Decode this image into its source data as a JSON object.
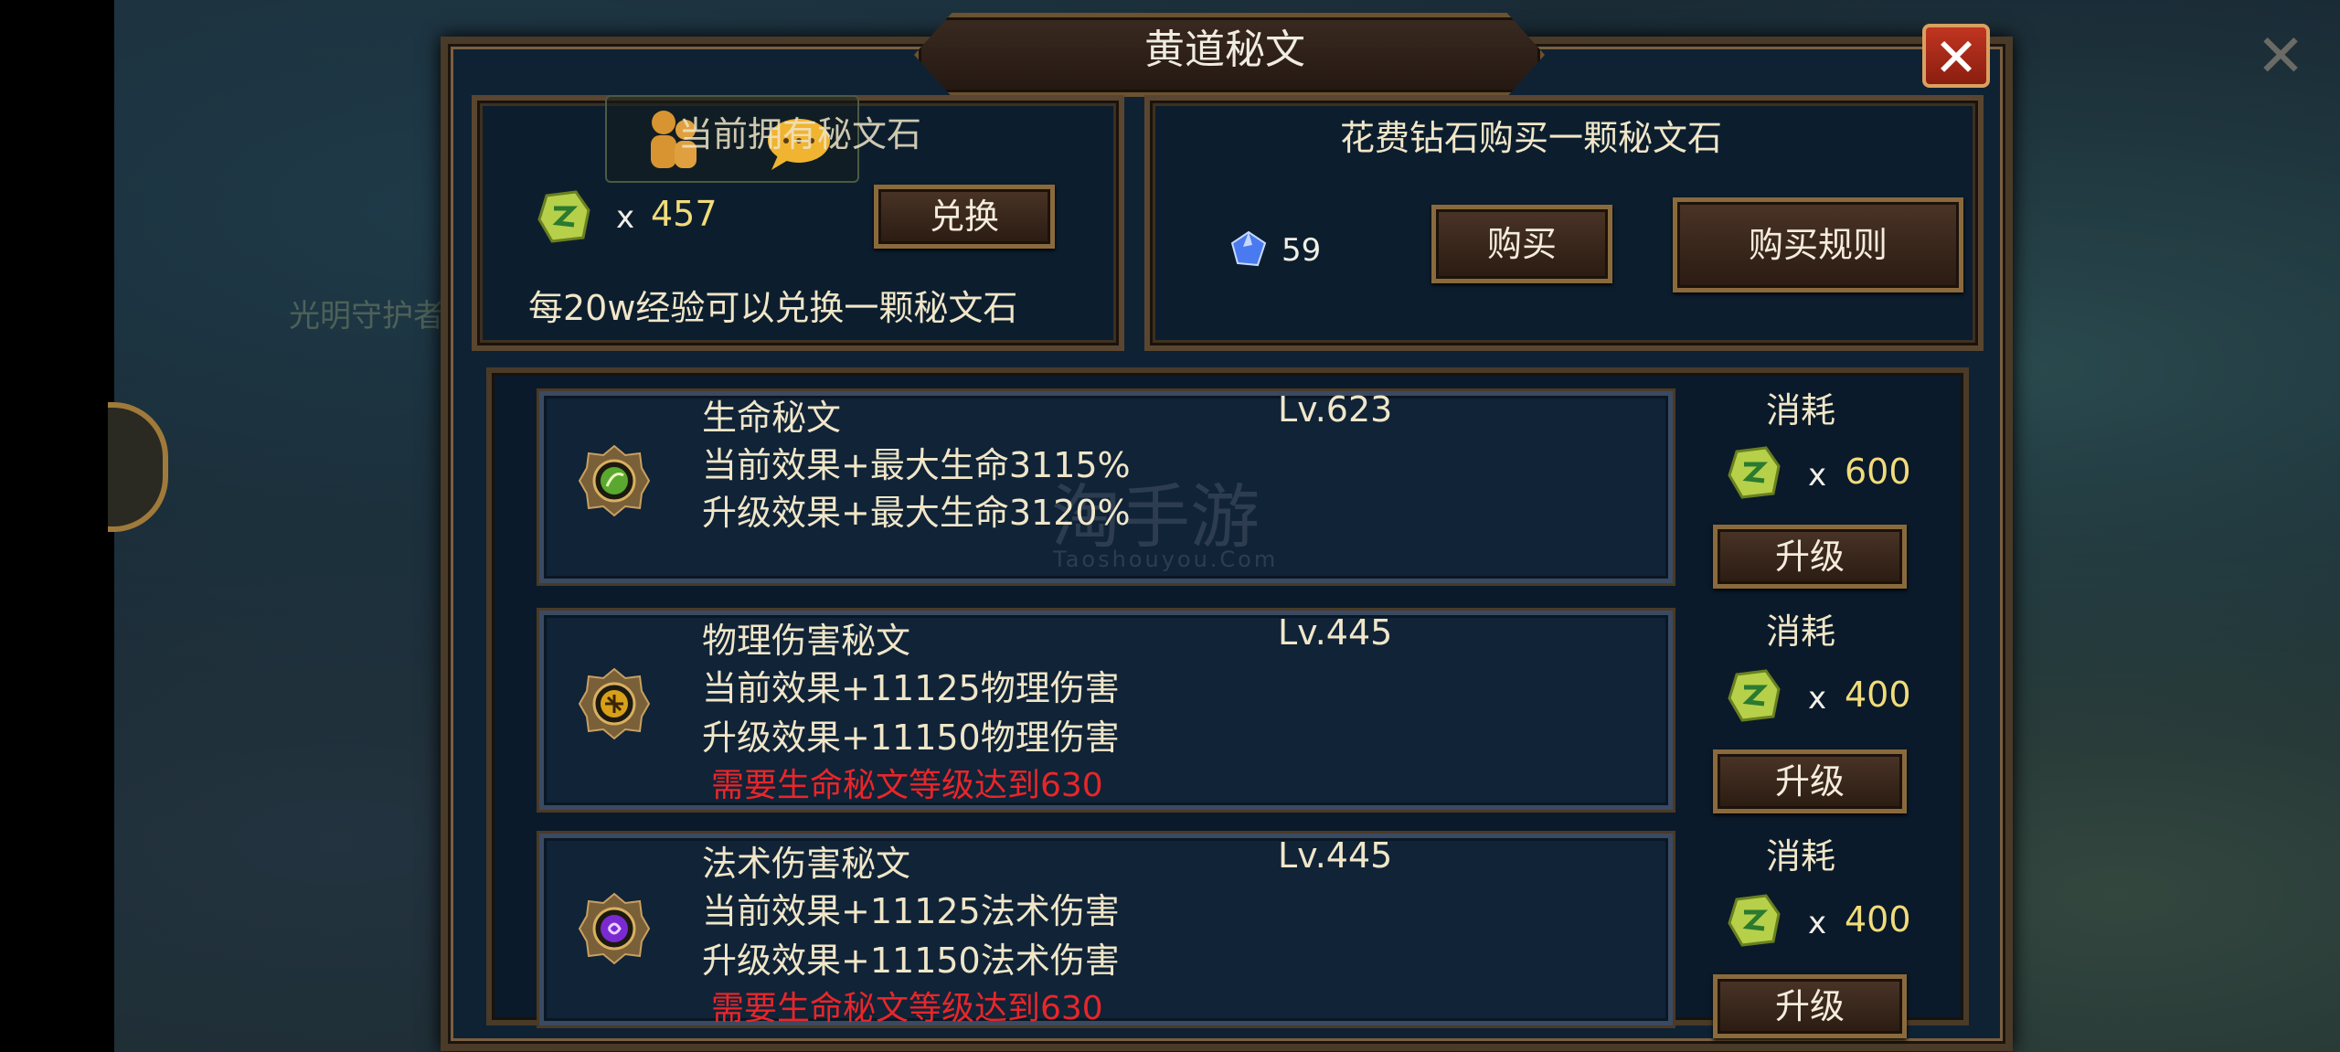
{
  "window": {
    "title": "黄道秘文",
    "close_symbol": "✕"
  },
  "background": {
    "close_symbol": "✕",
    "side_text": "光明守护者"
  },
  "stones_panel": {
    "label": "当前拥有秘文石",
    "count_prefix": "x",
    "count": "457",
    "exchange_button": "兑换",
    "hint": "每20w经验可以兑换一颗秘文石"
  },
  "purchase_panel": {
    "label": "花费钻石购买一颗秘文石",
    "diamond_count": "59",
    "buy_button": "购买",
    "rules_button": "购买规则"
  },
  "runes": [
    {
      "name": "生命秘文",
      "level": "Lv.623",
      "current": "当前效果+最大生命3115%",
      "upgrade": "升级效果+最大生命3120%",
      "requirement": "",
      "cost_label": "消耗",
      "cost_prefix": "x",
      "cost": "600",
      "upgrade_button": "升级",
      "icon": "life-rune-icon",
      "icon_color": "#5aa830"
    },
    {
      "name": "物理伤害秘文",
      "level": "Lv.445",
      "current": "当前效果+11125物理伤害",
      "upgrade": "升级效果+11150物理伤害",
      "requirement": "需要生命秘文等级达到630",
      "cost_label": "消耗",
      "cost_prefix": "x",
      "cost": "400",
      "upgrade_button": "升级",
      "icon": "physical-rune-icon",
      "icon_color": "#d8a018"
    },
    {
      "name": "法术伤害秘文",
      "level": "Lv.445",
      "current": "当前效果+11125法术伤害",
      "upgrade": "升级效果+11150法术伤害",
      "requirement": "需要生命秘文等级达到630",
      "cost_label": "消耗",
      "cost_prefix": "x",
      "cost": "400",
      "upgrade_button": "升级",
      "icon": "magic-rune-icon",
      "icon_color": "#7a2ad0"
    }
  ],
  "watermark": {
    "main": "淘手游",
    "sub": "Taoshouyou.Com"
  },
  "colors": {
    "panel_bg": "#0f2233",
    "frame": "#5a4630",
    "text_yellow": "#f2dc7a",
    "text_red": "#e8262a",
    "close_red": "#c03520"
  }
}
